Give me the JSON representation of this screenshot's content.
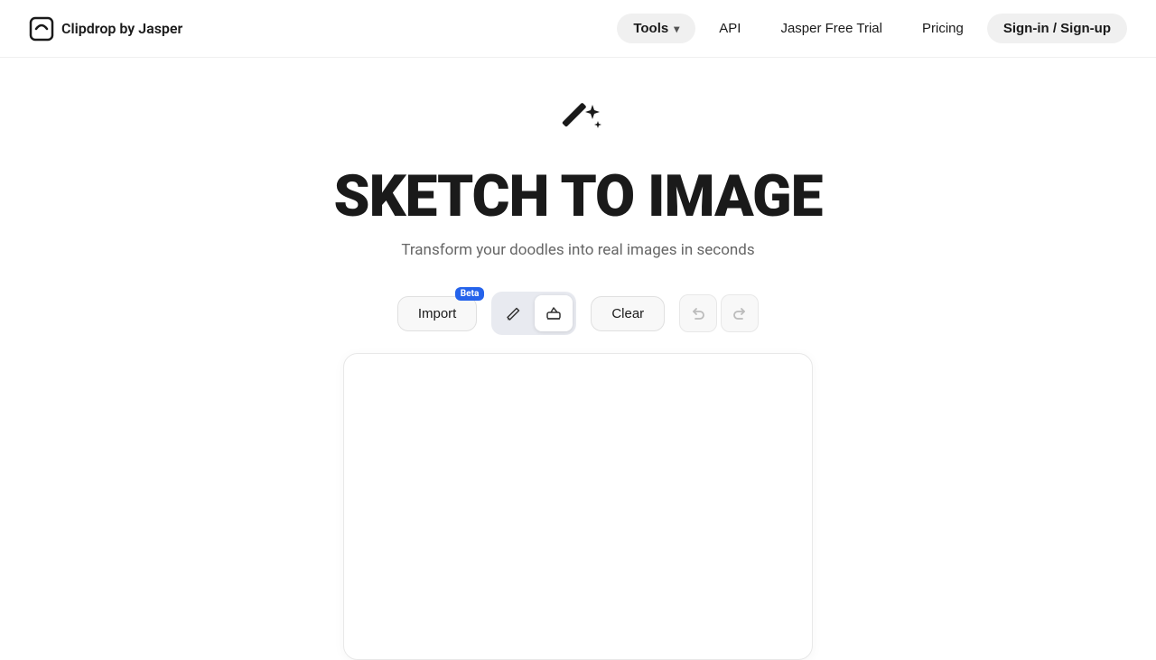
{
  "navbar": {
    "logo_text": "Clipdrop by Jasper",
    "tools_label": "Tools",
    "api_label": "API",
    "jasper_trial_label": "Jasper Free Trial",
    "pricing_label": "Pricing",
    "signin_label": "Sign-in / Sign-up"
  },
  "hero": {
    "title": "SKETCH TO IMAGE",
    "subtitle": "Transform your doodles into real images in seconds"
  },
  "toolbar": {
    "import_label": "Import",
    "beta_label": "Beta",
    "clear_label": "Clear"
  }
}
